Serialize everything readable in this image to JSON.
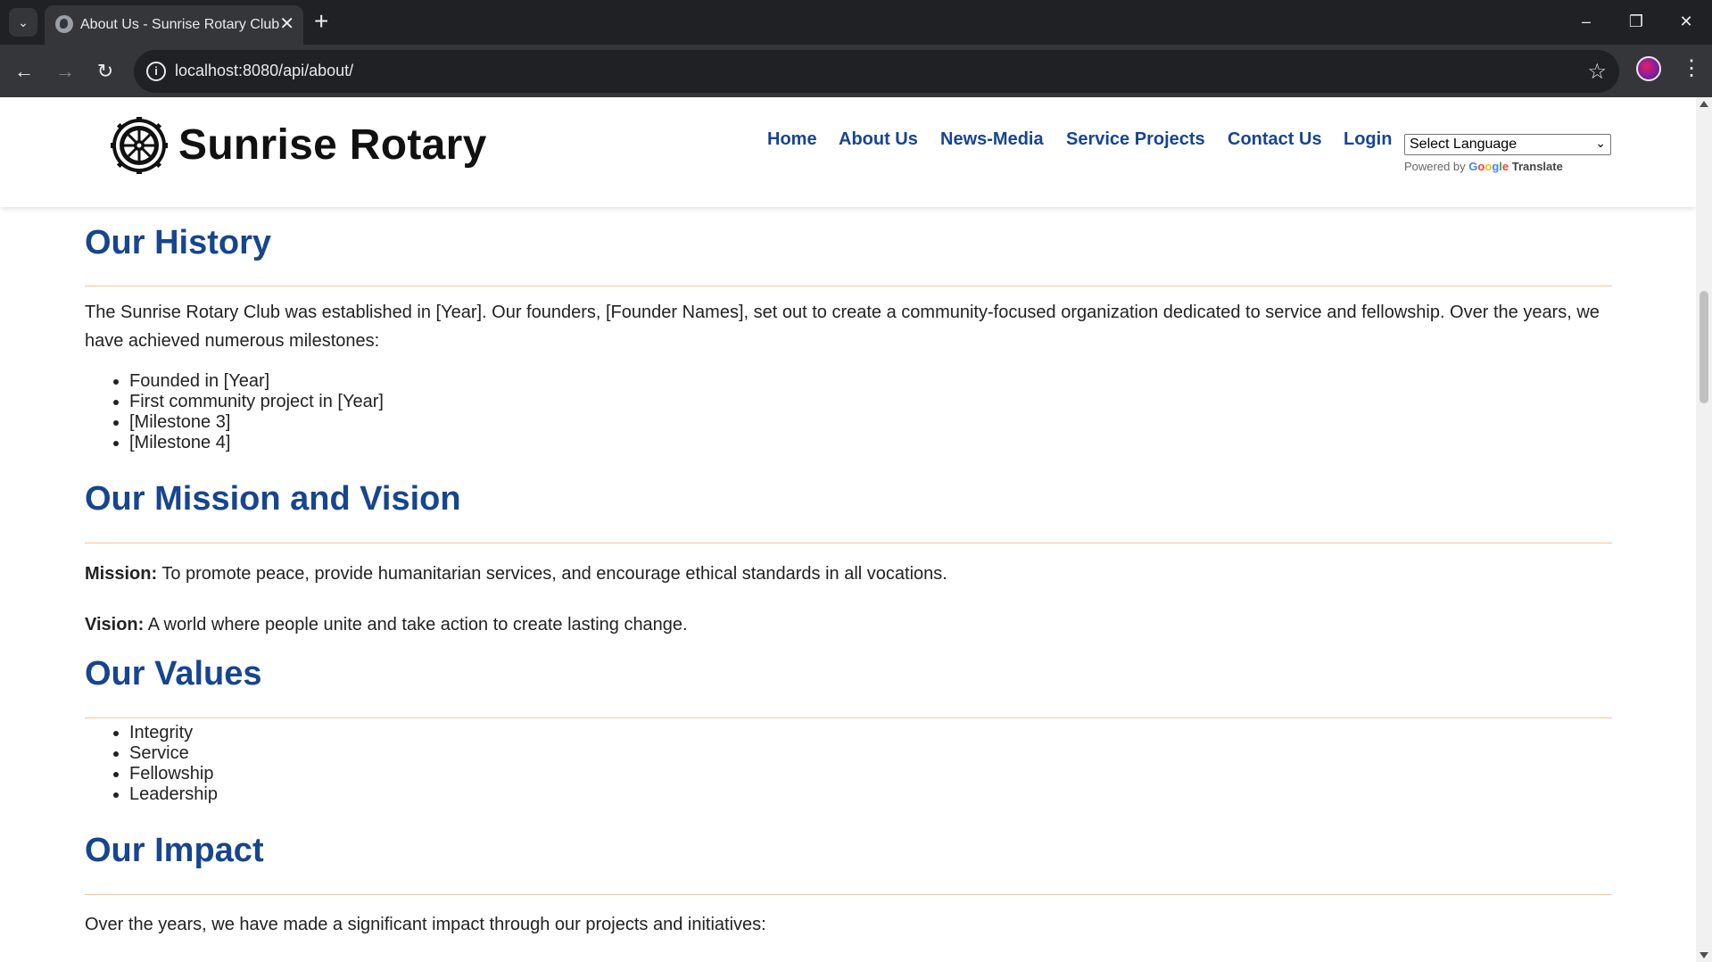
{
  "browser": {
    "tab_title": "About Us - Sunrise Rotary Club",
    "url": "localhost:8080/api/about/"
  },
  "site": {
    "brand": "Sunrise Rotary",
    "nav": [
      "Home",
      "About Us",
      "News-Media",
      "Service Projects",
      "Contact Us",
      "Login"
    ],
    "language_select": "Select Language",
    "powered_by": "Powered by",
    "google": "Google",
    "translate": "Translate"
  },
  "history": {
    "heading": "Our History",
    "intro": "The Sunrise Rotary Club was established in [Year]. Our founders, [Founder Names], set out to create a community-focused organization dedicated to service and fellowship. Over the years, we have achieved numerous milestones:",
    "milestones": [
      "Founded in [Year]",
      "First community project in [Year]",
      "[Milestone 3]",
      "[Milestone 4]"
    ]
  },
  "mission": {
    "heading": "Our Mission and Vision",
    "mission_label": "Mission:",
    "mission_text": "To promote peace, provide humanitarian services, and encourage ethical standards in all vocations.",
    "vision_label": "Vision:",
    "vision_text": "A world where people unite and take action to create lasting change."
  },
  "values": {
    "heading": "Our Values",
    "items": [
      "Integrity",
      "Service",
      "Fellowship",
      "Leadership"
    ]
  },
  "impact": {
    "heading": "Our Impact",
    "intro": "Over the years, we have made a significant impact through our projects and initiatives:"
  },
  "colors": {
    "heading": "#17458f",
    "rule": "#f7c58a",
    "chrome_dark": "#202124",
    "chrome_toolbar": "#35363a"
  }
}
